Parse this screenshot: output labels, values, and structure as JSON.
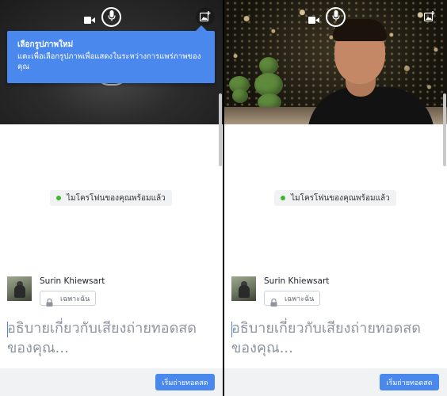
{
  "tooltip": {
    "title": "เลือกรูปภาพใหม่",
    "body": "แตะเพื่อเลือกรูปภาพเพื่อแสดงในระหว่างการแพร่ภาพของคุณ"
  },
  "mic_status": "ไมโครโฟนของคุณพร้อมแล้ว",
  "user": {
    "name": "Surin Khiewsart",
    "privacy": "เฉพาะฉัน"
  },
  "caption_placeholder": "อธิบายเกี่ยวกับเสียงถ่ายทอดสดของคุณ...",
  "go_live_button": "เริ่มถ่ายทอดสด",
  "icons": {
    "video": "video-camera-icon",
    "mic": "microphone-icon",
    "photo": "add-photo-icon",
    "lock": "lock-icon"
  },
  "colors": {
    "accent": "#4a88ee",
    "ready_dot": "#42b72a"
  }
}
